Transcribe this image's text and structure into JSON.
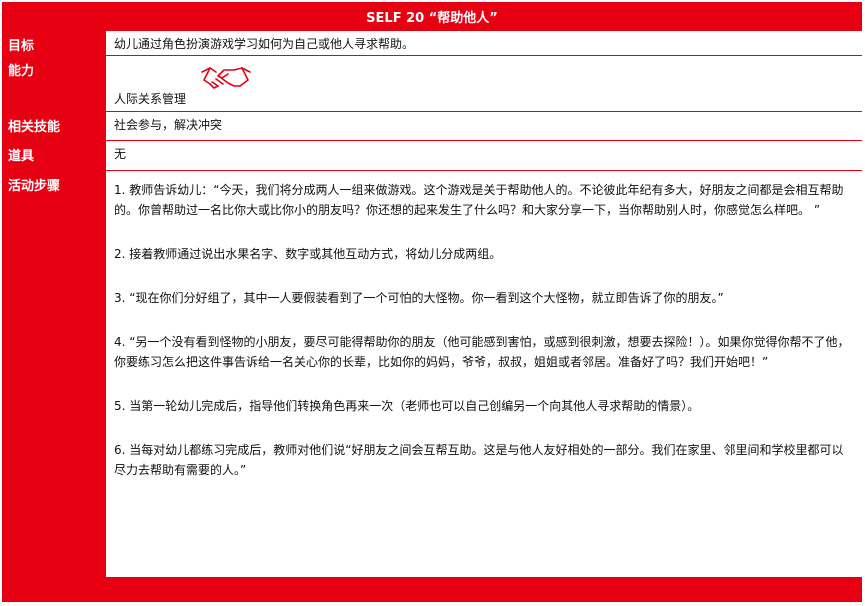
{
  "header": {
    "title": "SELF 20 “帮助他人”"
  },
  "rows": {
    "target": {
      "label": "目标",
      "value": "幼儿通过角色扮演游戏学习如何为自己或他人寻求帮助。"
    },
    "ability": {
      "label": "能力",
      "value": "人际关系管理",
      "icon": "handshake-icon",
      "icon_color": "#e60012"
    },
    "skills": {
      "label": "相关技能",
      "value": "社会参与，解决冲突"
    },
    "props": {
      "label": "道具",
      "value": "无"
    },
    "steps": {
      "label": "活动步骤",
      "items": [
        "1. 教师告诉幼儿：“今天，我们将分成两人一组来做游戏。这个游戏是关于帮助他人的。不论彼此年纪有多大，好朋友之间都是会相互帮助的。你曾帮助过一名比你大或比你小的朋友吗？你还想的起来发生了什么吗？和大家分享一下，当你帮助别人时，你感觉怎么样吧。 ”",
        "2. 接着教师通过说出水果名字、数字或其他互动方式，将幼儿分成两组。",
        "3. “现在你们分好组了，其中一人要假装看到了一个可怕的大怪物。你一看到这个大怪物，就立即告诉了你的朋友。”",
        "4. “另一个没有看到怪物的小朋友，要尽可能得帮助你的朋友（他可能感到害怕，或感到很刺激，想要去探险！）。如果你觉得你帮不了他，你要练习怎么把这件事告诉给一名关心你的长辈，比如你的妈妈，爷爷，叔叔，姐姐或者邻居。准备好了吗？我们开始吧！”",
        "5. 当第一轮幼儿完成后，指导他们转换角色再来一次（老师也可以自己创编另一个向其他人寻求帮助的情景）。",
        "6. 当每对幼儿都练习完成后，教师对他们说“好朋友之间会互帮互助。这是与他人友好相处的一部分。我们在家里、邻里间和学校里都可以尽力去帮助有需要的人。”"
      ]
    }
  },
  "colors": {
    "accent": "#e60012",
    "cell_bg": "#ffffff",
    "text": "#111111"
  }
}
